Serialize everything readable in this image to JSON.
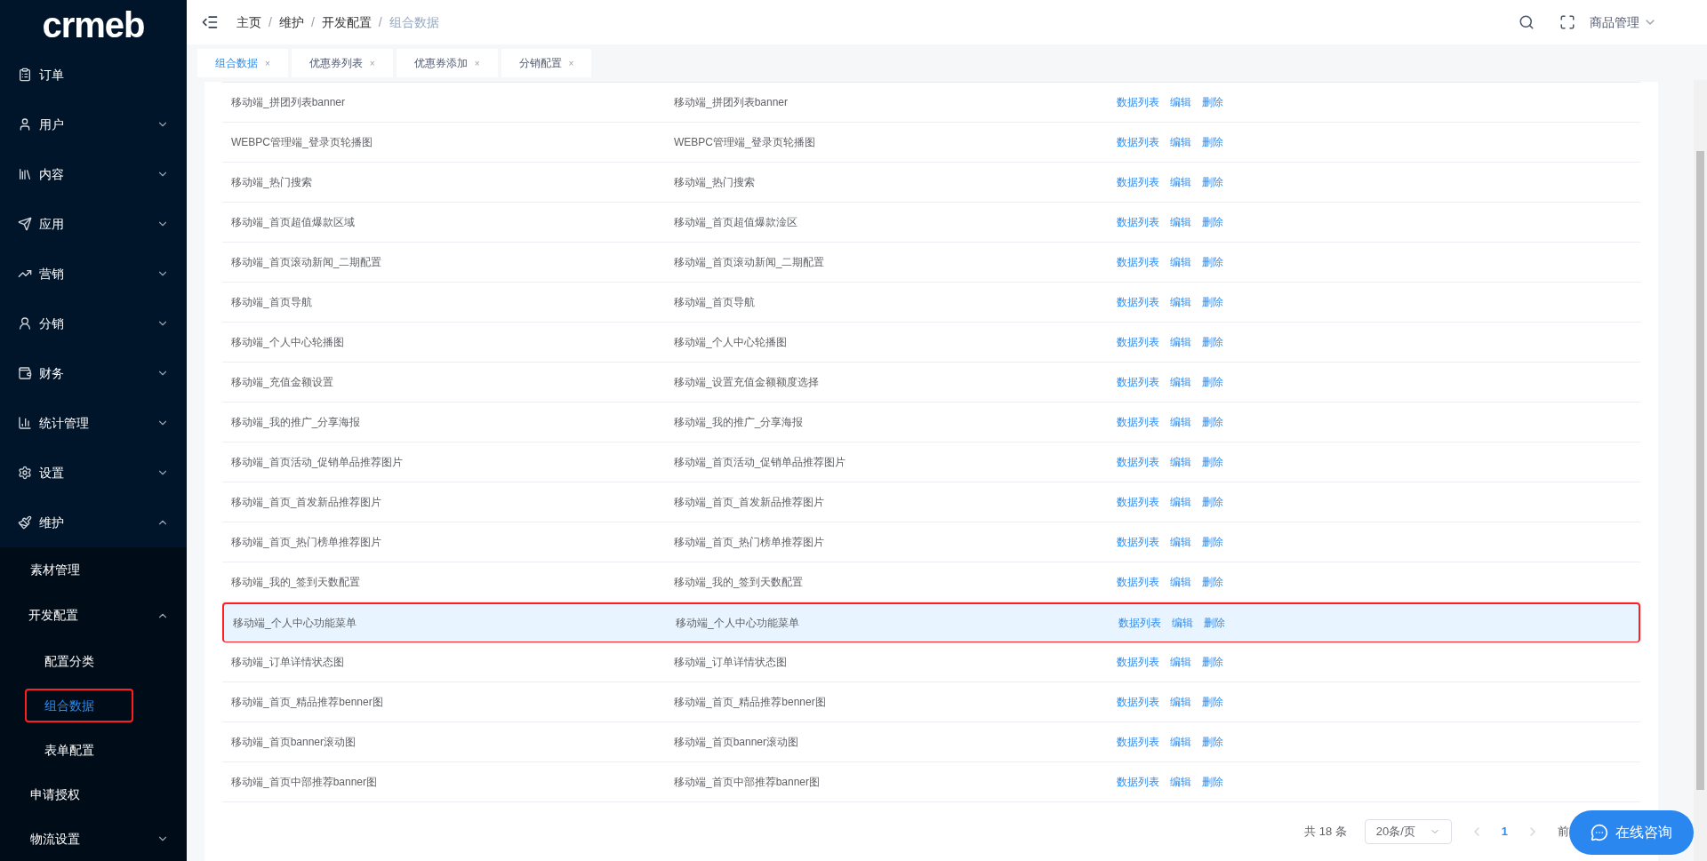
{
  "logo": "crmeb",
  "sidebar": {
    "items": [
      {
        "label": "订单",
        "expanded": false,
        "has_children": false
      },
      {
        "label": "用户",
        "expanded": false,
        "has_children": true
      },
      {
        "label": "内容",
        "expanded": false,
        "has_children": true
      },
      {
        "label": "应用",
        "expanded": false,
        "has_children": true
      },
      {
        "label": "营销",
        "expanded": false,
        "has_children": true
      },
      {
        "label": "分销",
        "expanded": false,
        "has_children": true
      },
      {
        "label": "财务",
        "expanded": false,
        "has_children": true
      },
      {
        "label": "统计管理",
        "expanded": false,
        "has_children": true
      },
      {
        "label": "设置",
        "expanded": false,
        "has_children": true
      },
      {
        "label": "维护",
        "expanded": true,
        "has_children": true,
        "children": [
          {
            "label": "素材管理",
            "selected": false,
            "marked": false
          },
          {
            "label": "开发配置",
            "expanded": true,
            "children": [
              {
                "label": "配置分类",
                "selected": false,
                "marked": false
              },
              {
                "label": "组合数据",
                "selected": true,
                "marked": true
              },
              {
                "label": "表单配置",
                "selected": false,
                "marked": false
              }
            ]
          },
          {
            "label": "申请授权",
            "selected": false,
            "marked": false
          },
          {
            "label": "物流设置",
            "selected": false,
            "marked": false,
            "expandable": true
          }
        ]
      }
    ]
  },
  "breadcrumb": [
    {
      "kind": "link",
      "text": "主页"
    },
    {
      "kind": "separator",
      "text": "/"
    },
    {
      "kind": "link",
      "text": "维护"
    },
    {
      "kind": "separator",
      "text": "/"
    },
    {
      "kind": "link",
      "text": "开发配置"
    },
    {
      "kind": "separator",
      "text": "/"
    },
    {
      "kind": "current",
      "text": "组合数据"
    }
  ],
  "header_menu": "商品管理",
  "tabs": [
    {
      "label": "组合数据",
      "close": "×",
      "selected": true
    },
    {
      "label": "优惠券列表",
      "close": "×",
      "selected": false
    },
    {
      "label": "优惠券添加",
      "close": "×",
      "selected": false
    },
    {
      "label": "分销配置",
      "close": "×",
      "selected": false
    }
  ],
  "table": {
    "rows": [
      {
        "name": "移动端_拼团列表banner",
        "key": "移动端_拼团列表banner",
        "highlighted": false,
        "actions": [
          "数据列表",
          "编辑",
          "删除"
        ]
      },
      {
        "name": "WEBPC管理端_登录页轮播图",
        "key": "WEBPC管理端_登录页轮播图",
        "highlighted": false,
        "actions": [
          "数据列表",
          "编辑",
          "删除"
        ]
      },
      {
        "name": "移动端_热门搜索",
        "key": "移动端_热门搜索",
        "highlighted": false,
        "actions": [
          "数据列表",
          "编辑",
          "删除"
        ]
      },
      {
        "name": "移动端_首页超值爆款区域",
        "key": "移动端_首页超值爆款淦区",
        "highlighted": false,
        "actions": [
          "数据列表",
          "编辑",
          "删除"
        ]
      },
      {
        "name": "移动端_首页滚动新闻_二期配置",
        "key": "移动端_首页滚动新闻_二期配置",
        "highlighted": false,
        "actions": [
          "数据列表",
          "编辑",
          "删除"
        ]
      },
      {
        "name": "移动端_首页导航",
        "key": "移动端_首页导航",
        "highlighted": false,
        "actions": [
          "数据列表",
          "编辑",
          "删除"
        ]
      },
      {
        "name": "移动端_个人中心轮播图",
        "key": "移动端_个人中心轮播图",
        "highlighted": false,
        "actions": [
          "数据列表",
          "编辑",
          "删除"
        ]
      },
      {
        "name": "移动端_充值金额设置",
        "key": "移动端_设置充值金额额度选择",
        "highlighted": false,
        "actions": [
          "数据列表",
          "编辑",
          "删除"
        ]
      },
      {
        "name": "移动端_我的推广_分享海报",
        "key": "移动端_我的推广_分享海报",
        "highlighted": false,
        "actions": [
          "数据列表",
          "编辑",
          "删除"
        ]
      },
      {
        "name": "移动端_首页活动_促销单品推荐图片",
        "key": "移动端_首页活动_促销单品推荐图片",
        "highlighted": false,
        "actions": [
          "数据列表",
          "编辑",
          "删除"
        ]
      },
      {
        "name": "移动端_首页_首发新品推荐图片",
        "key": "移动端_首页_首发新品推荐图片",
        "highlighted": false,
        "actions": [
          "数据列表",
          "编辑",
          "删除"
        ]
      },
      {
        "name": "移动端_首页_热门榜单推荐图片",
        "key": "移动端_首页_热门榜单推荐图片",
        "highlighted": false,
        "actions": [
          "数据列表",
          "编辑",
          "删除"
        ]
      },
      {
        "name": "移动端_我的_签到天数配置",
        "key": "移动端_我的_签到天数配置",
        "highlighted": false,
        "actions": [
          "数据列表",
          "编辑",
          "删除"
        ]
      },
      {
        "name": "移动端_个人中心功能菜单",
        "key": "移动端_个人中心功能菜单",
        "highlighted": true,
        "actions": [
          "数据列表",
          "编辑",
          "删除"
        ]
      },
      {
        "name": "移动端_订单详情状态图",
        "key": "移动端_订单详情状态图",
        "highlighted": false,
        "actions": [
          "数据列表",
          "编辑",
          "删除"
        ]
      },
      {
        "name": "移动端_首页_精品推荐benner图",
        "key": "移动端_首页_精品推荐benner图",
        "highlighted": false,
        "actions": [
          "数据列表",
          "编辑",
          "删除"
        ]
      },
      {
        "name": "移动端_首页banner滚动图",
        "key": "移动端_首页banner滚动图",
        "highlighted": false,
        "actions": [
          "数据列表",
          "编辑",
          "删除"
        ]
      },
      {
        "name": "移动端_首页中部推荐banner图",
        "key": "移动端_首页中部推荐banner图",
        "highlighted": false,
        "actions": [
          "数据列表",
          "编辑",
          "删除"
        ]
      }
    ]
  },
  "pagination": {
    "total": "共 18 条",
    "page_size": "20条/页",
    "pages": [
      {
        "label": "1",
        "selected": true
      }
    ],
    "goto": "前"
  },
  "chat_button": "在线咨询"
}
